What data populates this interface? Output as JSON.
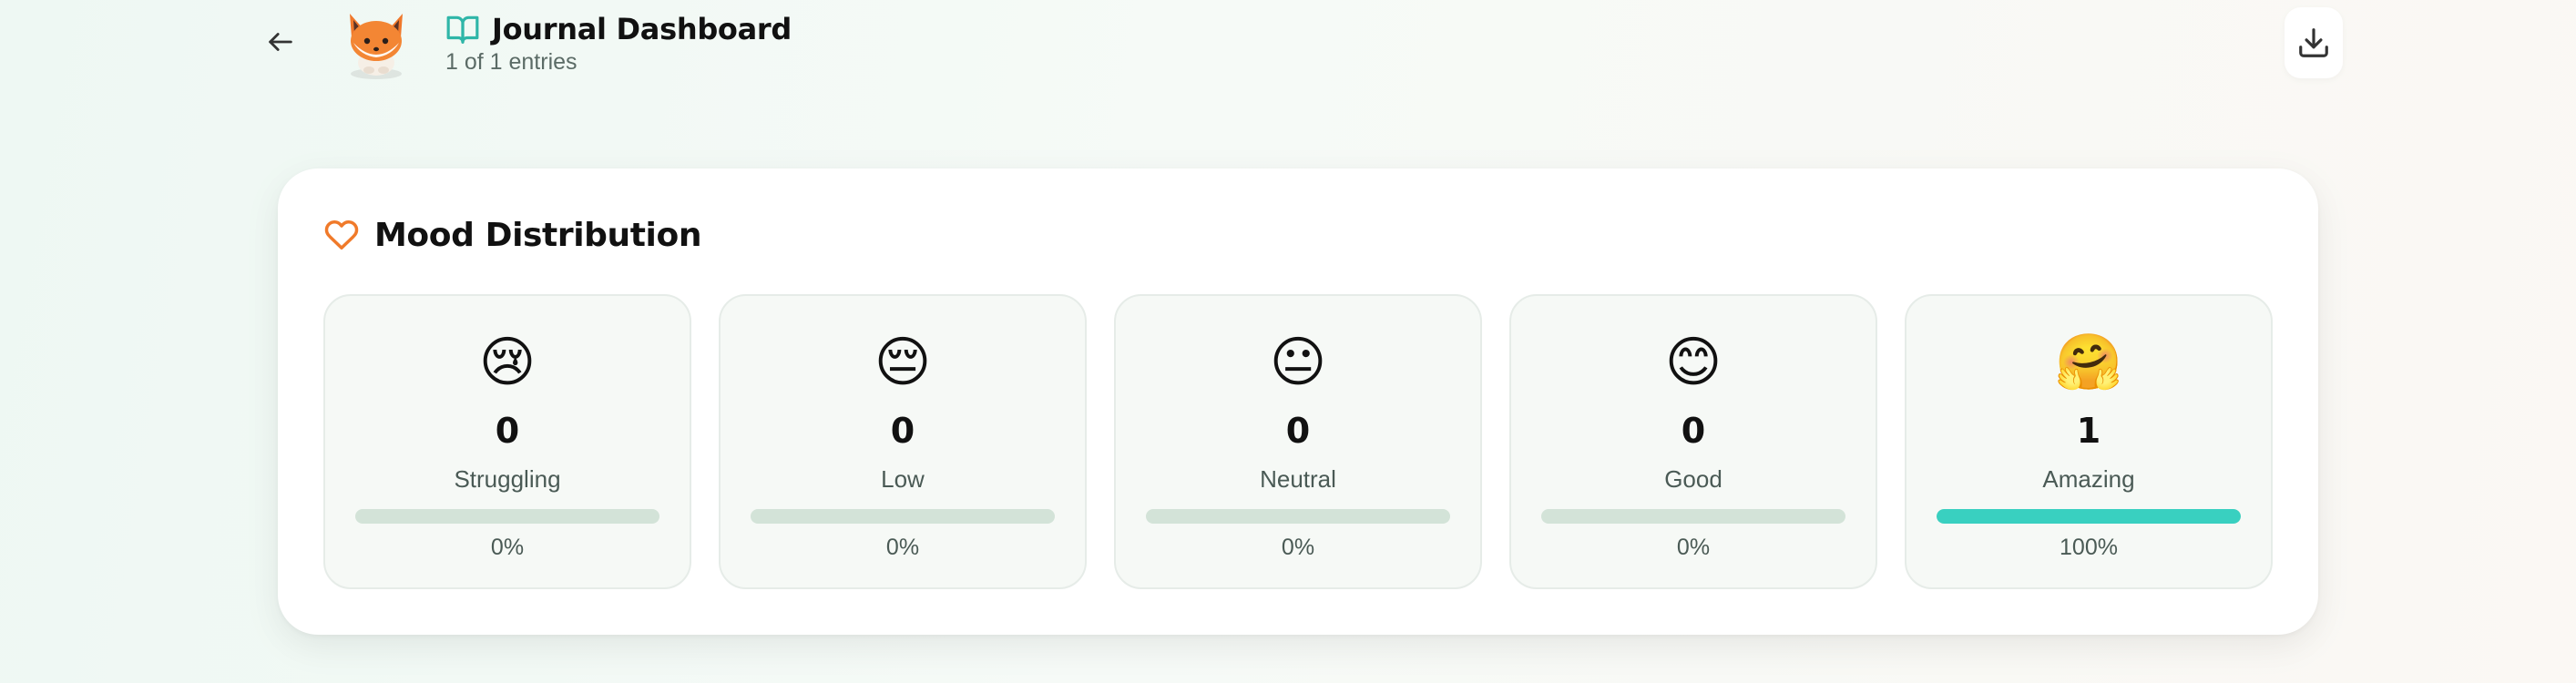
{
  "header": {
    "title": "Journal Dashboard",
    "subtitle": "1 of 1 entries",
    "icons": {
      "back": "arrow-left-icon",
      "avatar": "fox-avatar",
      "title": "open-book-icon",
      "download": "download-icon"
    },
    "accent_color": "#2fb6a8"
  },
  "mood": {
    "title": "Mood Distribution",
    "title_icon": "heart-icon",
    "title_icon_color": "#f07a2a",
    "bar_fill_color": "#39d0c0",
    "bar_track_color": "#d3e3d8",
    "items": [
      {
        "emoji": "😢",
        "count": "0",
        "label": "Struggling",
        "percent_text": "0%",
        "fraction": 0
      },
      {
        "emoji": "😔",
        "count": "0",
        "label": "Low",
        "percent_text": "0%",
        "fraction": 0
      },
      {
        "emoji": "😐",
        "count": "0",
        "label": "Neutral",
        "percent_text": "0%",
        "fraction": 0
      },
      {
        "emoji": "😊",
        "count": "0",
        "label": "Good",
        "percent_text": "0%",
        "fraction": 0
      },
      {
        "emoji": "🤗",
        "count": "1",
        "label": "Amazing",
        "percent_text": "100%",
        "fraction": 1
      }
    ]
  }
}
